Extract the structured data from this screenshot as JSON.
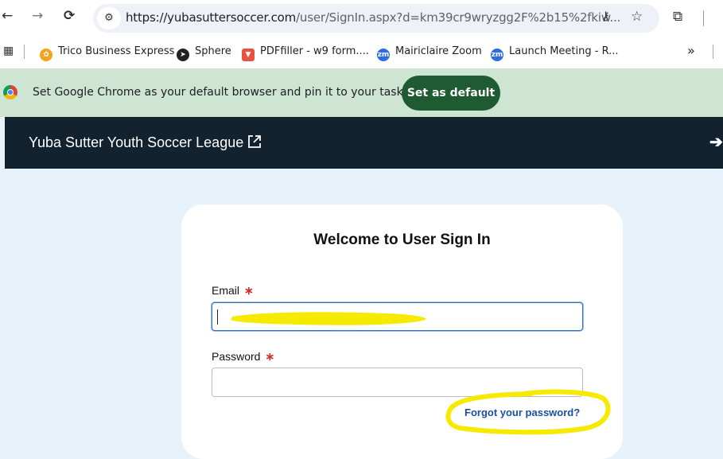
{
  "browser": {
    "url_host": "https://yubasuttersoccer.com",
    "url_path": "/user/SignIn.aspx?d=km39cr9wryzgg2F%2b15%2fkiw...",
    "bookmarks": [
      {
        "label": "Trico Business Express",
        "icon": "trico-icon"
      },
      {
        "label": "Sphere",
        "icon": "sphere-icon"
      },
      {
        "label": "PDFfiller - w9 form....",
        "icon": "pdffiller-icon"
      },
      {
        "label": "Mairiclaire Zoom",
        "icon": "zoom-icon"
      },
      {
        "label": "Launch Meeting - R...",
        "icon": "zoom-icon"
      }
    ],
    "overflow_label": "»",
    "infobar": {
      "text": "Set Google Chrome as your default browser and pin it to your taskbar",
      "button": "Set as default"
    }
  },
  "site": {
    "title": "Yuba Sutter Youth Soccer League"
  },
  "signin": {
    "heading": "Welcome to User Sign In",
    "email_label": "Email",
    "password_label": "Password",
    "required_mark": "∗",
    "forgot_link": "Forgot your password?"
  },
  "colors": {
    "header_bg": "#13222f",
    "page_bg": "#e7f2fb",
    "infobar_bg": "#cde5d2",
    "set_default_bg": "#1e5a32",
    "highlight": "#f5ea00"
  }
}
